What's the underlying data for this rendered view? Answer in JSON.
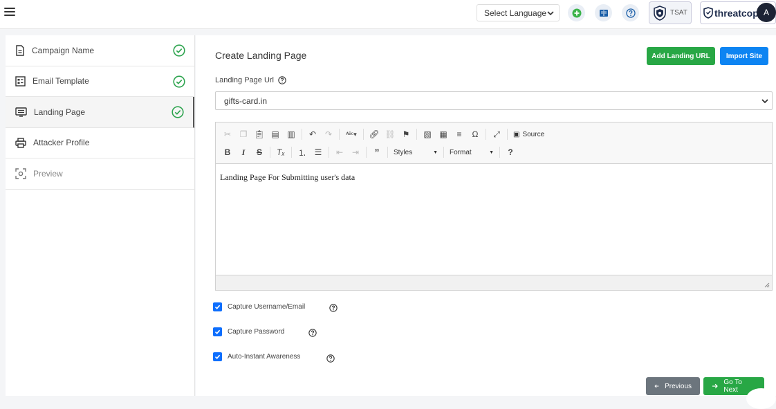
{
  "header": {
    "language_select": "Select Language",
    "tsat_label": "TSAT",
    "brand_name": "threatcop",
    "avatar_initial": "A",
    "colors": {
      "green_icon": "#3bb34a",
      "blue_icon": "#1b5fa8"
    }
  },
  "sidebar": {
    "items": [
      {
        "label": "Campaign Name",
        "icon": "document-icon",
        "completed": true
      },
      {
        "label": "Email Template",
        "icon": "template-icon",
        "completed": true
      },
      {
        "label": "Landing Page",
        "icon": "monitor-icon",
        "completed": true
      },
      {
        "label": "Attacker Profile",
        "icon": "printer-icon",
        "completed": false
      },
      {
        "label": "Preview",
        "icon": "preview-icon",
        "completed": false
      }
    ]
  },
  "main": {
    "title": "Create Landing Page",
    "add_landing_url_label": "Add Landing URL",
    "import_site_label": "Import Site",
    "landing_url_label": "Landing Page Url",
    "landing_url_value": "gifts-card.in",
    "editor": {
      "source_label": "Source",
      "styles_label": "Styles",
      "format_label": "Format",
      "content": "Landing Page For Submitting user's data"
    },
    "checkboxes": [
      {
        "label": "Capture Username/Email",
        "checked": true
      },
      {
        "label": "Capture Password",
        "checked": true
      },
      {
        "label": "Auto-Instant Awareness",
        "checked": true
      }
    ],
    "previous_label": "Previous",
    "next_label": "Go To Next"
  }
}
